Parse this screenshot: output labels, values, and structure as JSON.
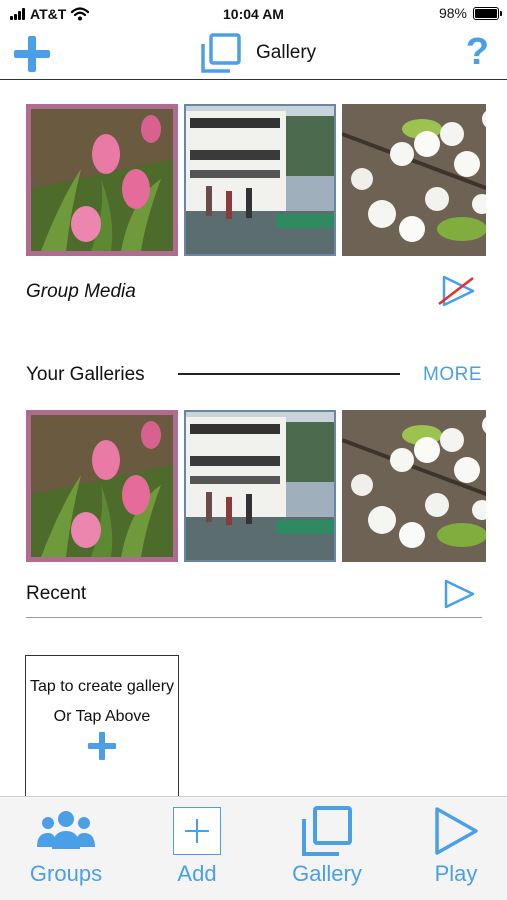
{
  "status_bar": {
    "carrier": "AT&T",
    "time": "10:04 AM",
    "battery": "98%",
    "battery_level": 0.98
  },
  "nav": {
    "title": "Gallery",
    "help_label": "?"
  },
  "group_media": {
    "label": "Group Media"
  },
  "your_galleries": {
    "label": "Your Galleries",
    "more_label": "MORE"
  },
  "recent": {
    "label": "Recent"
  },
  "create_card": {
    "line1": "Tap to create gallery",
    "line2": "Or Tap Above"
  },
  "tabs": [
    {
      "label": "Groups",
      "icon": "groups-icon"
    },
    {
      "label": "Add",
      "icon": "add-icon"
    },
    {
      "label": "Gallery",
      "icon": "gallery-icon"
    },
    {
      "label": "Play",
      "icon": "play-icon"
    }
  ],
  "colors": {
    "accent": "#4a9fe6",
    "disabled_strike": "#e0312b",
    "tulip_border": "#b06c90"
  },
  "icons": [
    "wifi-icon",
    "battery-icon",
    "plus-icon",
    "gallery-icon",
    "help-icon",
    "play-icon",
    "play-disabled-icon",
    "groups-icon"
  ]
}
